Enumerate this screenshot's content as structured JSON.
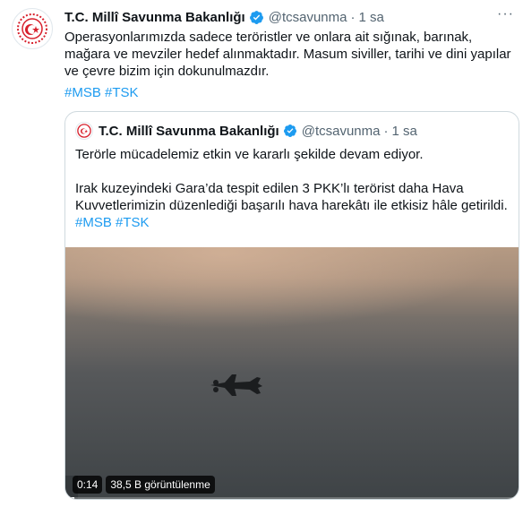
{
  "tweet": {
    "author_name": "T.C. Millî Savunma Bakanlığı",
    "handle": "@tcsavunma",
    "separator": "·",
    "time": "1 sa",
    "more_icon": "more-options-icon",
    "text": "Operasyonlarımızda sadece teröristler ve onlara ait sığınak, barınak, mağara ve mevziler hedef alınmaktadır. Masum siviller, tarihi ve dini yapılar ve çevre bizim için dokunulmazdır.",
    "hashtags": "#MSB #TSK"
  },
  "quoted": {
    "author_name": "T.C. Millî Savunma Bakanlığı",
    "handle": "@tcsavunma",
    "separator": "·",
    "time": "1 sa",
    "line1": "Terörle mücadelemiz etkin ve kararlı şekilde devam ediyor.",
    "line2": "Irak kuzeyindeki Gara’da tespit edilen 3 PKK’lı terörist daha Hava Kuvvetlerimizin düzenlediği başarılı hava harekâtı ile etkisiz hâle getirildi.",
    "hashtags": "#MSB #TSK",
    "video": {
      "duration": "0:14",
      "views": "38,5 B görüntülenme",
      "progress_fraction": 0.02
    }
  },
  "colors": {
    "verified": "#1d9bf0",
    "emblem_red": "#d7202c",
    "link": "#1d9bf0"
  },
  "icons": [
    "msb-logo",
    "verified-badge-icon",
    "more-options-icon",
    "fighter-jet-icon"
  ]
}
